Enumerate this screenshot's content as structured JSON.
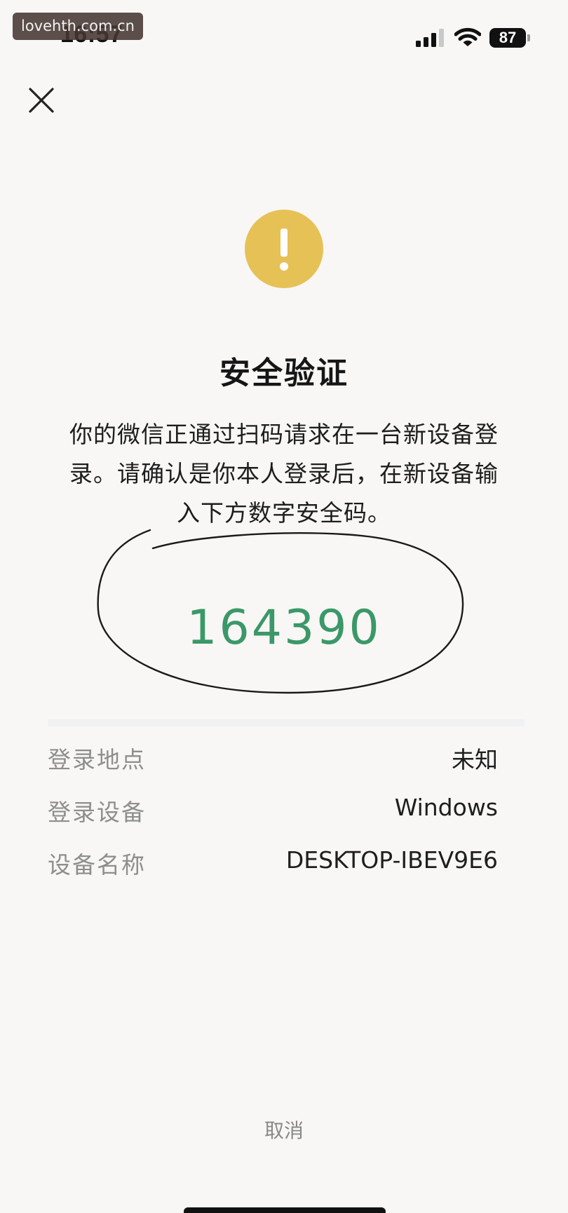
{
  "status_bar": {
    "time": "16:57",
    "battery": "87",
    "signal_icon": "cellular-signal-icon",
    "wifi_icon": "wifi-icon"
  },
  "watermark": "lovehth.com.cn",
  "close_icon": "close-icon",
  "warning_icon": "exclamation-icon",
  "colors": {
    "warning": "#e6c156",
    "code": "#3b9868",
    "label": "#8e8e8e",
    "cancel": "#888888",
    "background": "#f8f7f5"
  },
  "title": "安全验证",
  "description": {
    "line1": "你的微信正通过扫码请求在一台新设备登",
    "line2": "录。请确认是你本人登录后，在新设备输",
    "line3": "入下方数字安全码。"
  },
  "security_code": "164390",
  "details": [
    {
      "label": "登录地点",
      "value": "未知"
    },
    {
      "label": "登录设备",
      "value": "Windows"
    },
    {
      "label": "设备名称",
      "value": "DESKTOP-IBEV9E6"
    }
  ],
  "cancel_label": "取消"
}
